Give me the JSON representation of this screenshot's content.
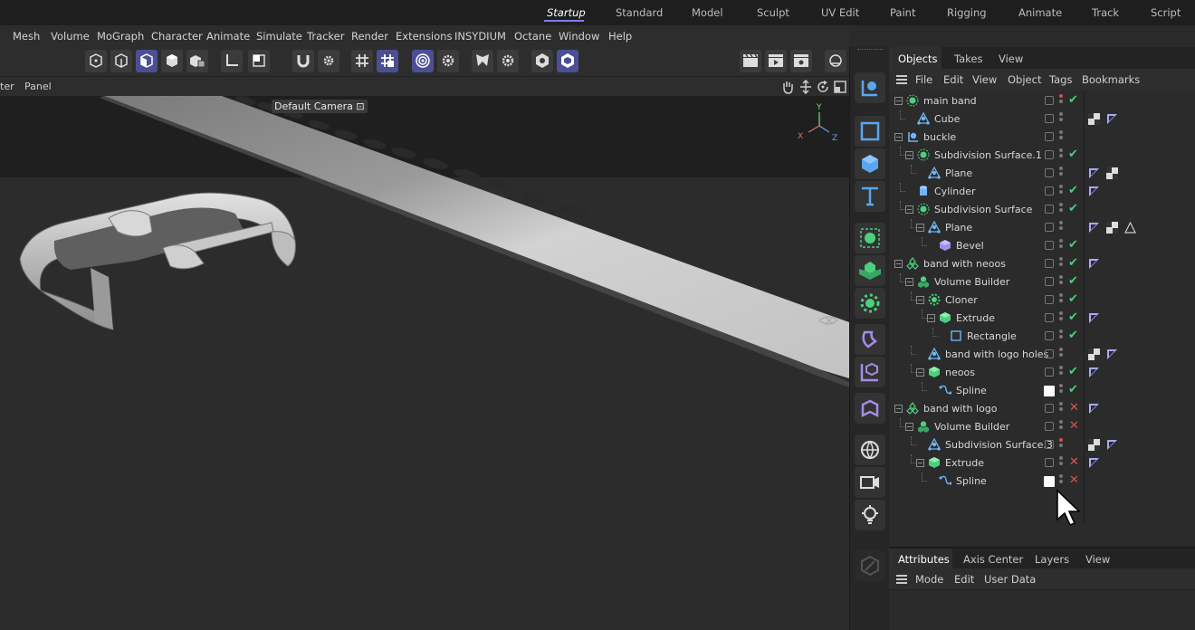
{
  "layouts": {
    "items": [
      "Startup",
      "Standard",
      "Model",
      "Sculpt",
      "UV Edit",
      "Paint",
      "Rigging",
      "Animate",
      "Track",
      "Script"
    ],
    "active": "Startup"
  },
  "menu": [
    "Mesh",
    "Volume",
    "MoGraph",
    "Character",
    "Animate",
    "Simulate",
    "Tracker",
    "Render",
    "Extensions",
    "INSYDIUM",
    "Octane",
    "Window",
    "Help"
  ],
  "viewport": {
    "menu_partial": "ter",
    "menu_panel": "Panel",
    "camera_label": "Default Camera",
    "camera_glyph": "⊡",
    "axes": {
      "x": "X",
      "y": "Y",
      "z": "Z"
    }
  },
  "object_manager": {
    "tabs": [
      "Objects",
      "Takes",
      "View"
    ],
    "active_tab": "Objects",
    "menu": [
      "File",
      "Edit",
      "View",
      "Object",
      "Tags",
      "Bookmarks"
    ],
    "objects": [
      {
        "name": "main band",
        "depth": 0,
        "icon": "subdivision-icon",
        "expander": "⊟",
        "status": "check",
        "dot": "red",
        "tags": []
      },
      {
        "name": "Cube",
        "depth": 1,
        "icon": "polygon-object-icon",
        "expander": "",
        "status": "none",
        "dot": "",
        "tags": [
          "checker-tag",
          "material-tag"
        ]
      },
      {
        "name": "buckle",
        "depth": 0,
        "icon": "null-object-icon",
        "expander": "⊟",
        "status": "none",
        "dot": "",
        "tags": []
      },
      {
        "name": "Subdivision Surface.1",
        "depth": 1,
        "icon": "subdivision-icon",
        "expander": "⊟",
        "status": "check",
        "dot": "",
        "tags": []
      },
      {
        "name": "Plane",
        "depth": 2,
        "icon": "polygon-object-icon",
        "expander": "",
        "status": "none",
        "dot": "",
        "tags": [
          "material-tag",
          "checker-tag"
        ]
      },
      {
        "name": "Cylinder",
        "depth": 1,
        "icon": "cylinder-icon",
        "expander": "",
        "status": "check",
        "dot": "",
        "tags": [
          "material-tag"
        ]
      },
      {
        "name": "Subdivision Surface",
        "depth": 1,
        "icon": "subdivision-icon",
        "expander": "⊟",
        "status": "check",
        "dot": "",
        "tags": []
      },
      {
        "name": "Plane",
        "depth": 2,
        "icon": "polygon-object-icon",
        "expander": "⊟",
        "status": "none",
        "dot": "",
        "tags": [
          "material-tag",
          "checker-tag",
          "phong-tag"
        ]
      },
      {
        "name": "Bevel",
        "depth": 3,
        "icon": "bevel-icon",
        "expander": "",
        "status": "check",
        "dot": "",
        "tags": []
      },
      {
        "name": "band with neoos",
        "depth": 0,
        "icon": "volume-mesher-icon",
        "expander": "⊟",
        "status": "check",
        "dot": "",
        "tags": [
          "material-tag"
        ]
      },
      {
        "name": "Volume Builder",
        "depth": 1,
        "icon": "volume-builder-icon",
        "expander": "⊟",
        "status": "check",
        "dot": "",
        "tags": []
      },
      {
        "name": "Cloner",
        "depth": 2,
        "icon": "cloner-icon",
        "expander": "⊟",
        "status": "check",
        "dot": "",
        "tags": []
      },
      {
        "name": "Extrude",
        "depth": 3,
        "icon": "extrude-icon",
        "expander": "⊟",
        "status": "check",
        "dot": "",
        "tags": [
          "material-tag"
        ]
      },
      {
        "name": "Rectangle",
        "depth": 4,
        "icon": "rectangle-spline-icon",
        "expander": "",
        "status": "check",
        "dot": "",
        "tags": []
      },
      {
        "name": "band with logo holes",
        "depth": 2,
        "icon": "polygon-object-icon",
        "expander": "",
        "status": "none",
        "dot": "",
        "tags": [
          "checker-tag",
          "material-tag"
        ]
      },
      {
        "name": "neoos",
        "depth": 2,
        "icon": "extrude-icon",
        "expander": "⊟",
        "status": "check",
        "dot": "",
        "tags": [
          "material-tag"
        ]
      },
      {
        "name": "Spline",
        "depth": 3,
        "icon": "spline-icon",
        "expander": "",
        "status": "check",
        "dot": "",
        "swatch": true,
        "tags": []
      },
      {
        "name": "band with logo",
        "depth": 0,
        "icon": "volume-mesher-icon",
        "expander": "⊟",
        "status": "cross",
        "dot": "",
        "tags": [
          "material-tag"
        ]
      },
      {
        "name": "Volume Builder",
        "depth": 1,
        "icon": "volume-builder-icon",
        "expander": "⊟",
        "status": "cross",
        "dot": "",
        "tags": []
      },
      {
        "name": "Subdivision Surface.3",
        "depth": 2,
        "icon": "polygon-object-icon",
        "expander": "",
        "status": "none",
        "dot": "red",
        "tags": [
          "checker-tag",
          "material-tag"
        ]
      },
      {
        "name": "Extrude",
        "depth": 2,
        "icon": "extrude-icon",
        "expander": "⊟",
        "status": "cross",
        "dot": "",
        "tags": [
          "material-tag"
        ]
      },
      {
        "name": "Spline",
        "depth": 3,
        "icon": "spline-icon",
        "expander": "",
        "status": "cross",
        "dot": "",
        "swatch": true,
        "tags": []
      }
    ]
  },
  "attributes": {
    "tabs": [
      "Attributes",
      "Axis Center",
      "Layers",
      "View"
    ],
    "active_tab": "Attributes",
    "menu": [
      "Mode",
      "Edit",
      "User Data"
    ]
  },
  "colors": {
    "accent": "#7d7df0",
    "active_tool": "#4d4f94",
    "check": "#4cd07d",
    "cross": "#e05050",
    "red_dot": "#e04848"
  }
}
